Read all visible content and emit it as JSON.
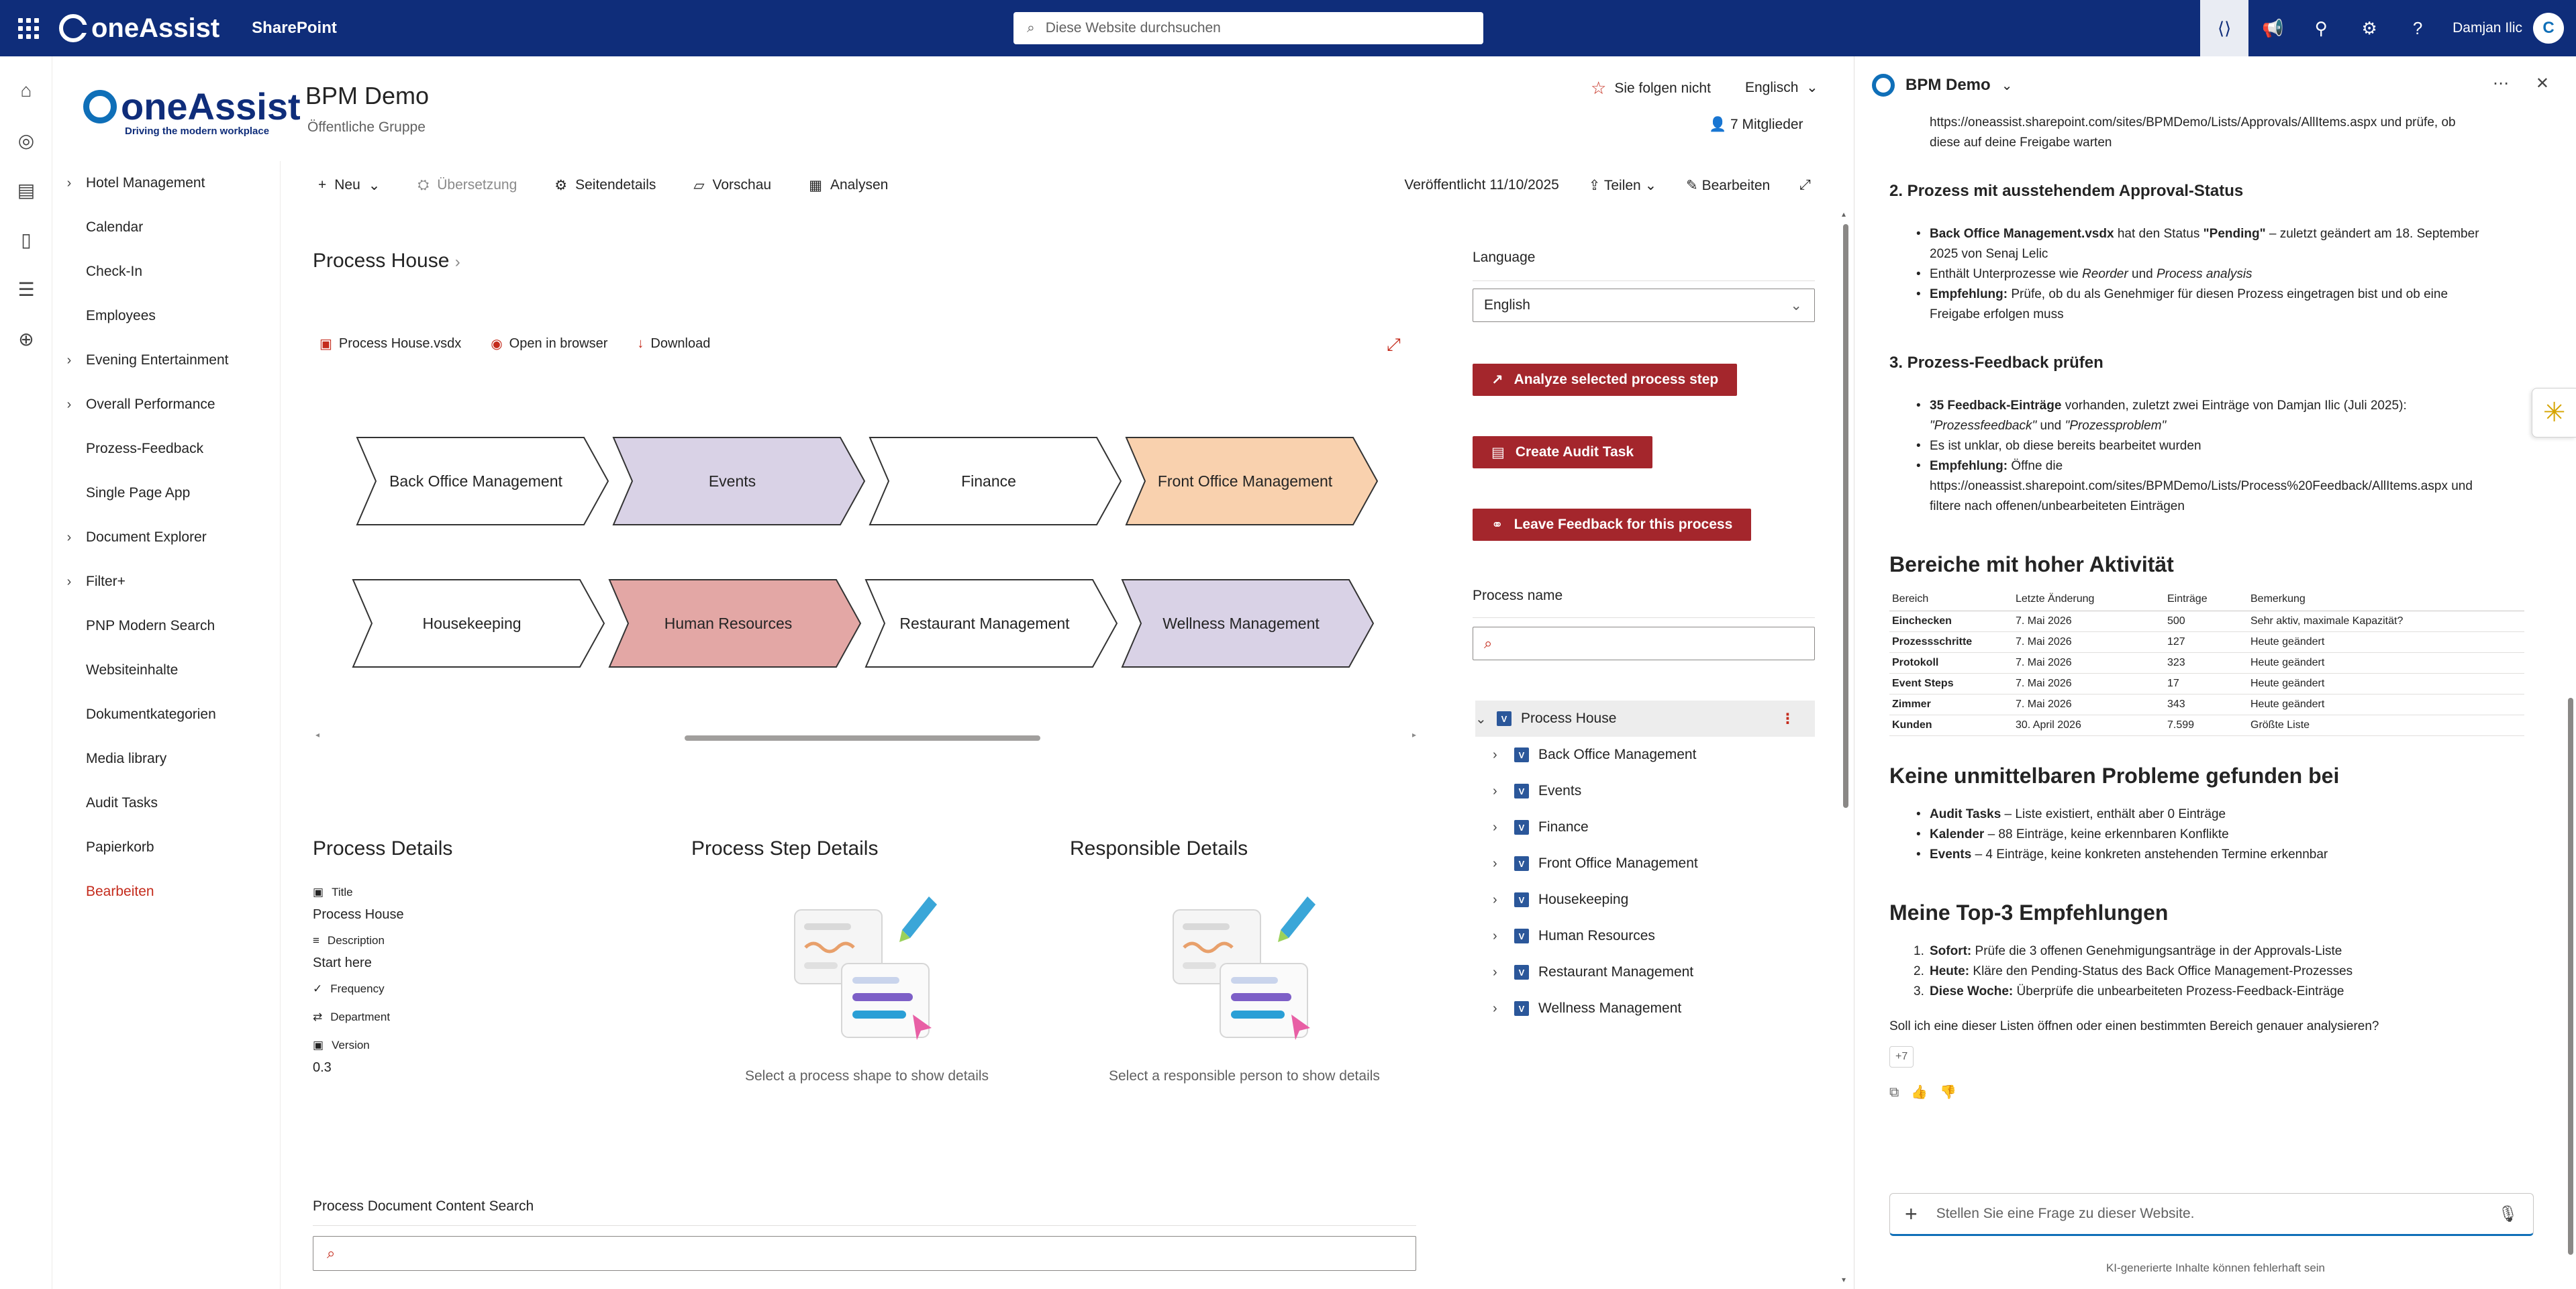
{
  "suitebar": {
    "brand": "oneAssist",
    "app": "SharePoint",
    "search_placeholder": "Diese Website durchsuchen",
    "user": "Damjan Ilic",
    "avatar_letter": "C"
  },
  "site": {
    "logo_brand": "oneAssist",
    "logo_tagline": "Driving the modern workplace",
    "title": "BPM Demo",
    "subtitle": "Öffentliche Gruppe",
    "follow": "Sie folgen nicht",
    "language": "Englisch",
    "members": "7 Mitglieder"
  },
  "nav": {
    "items": [
      {
        "label": "Hotel Management",
        "expandable": true
      },
      {
        "label": "Calendar",
        "expandable": false
      },
      {
        "label": "Check-In",
        "expandable": false
      },
      {
        "label": "Employees",
        "expandable": false
      },
      {
        "label": "Evening Entertainment",
        "expandable": true
      },
      {
        "label": "Overall Performance",
        "expandable": true
      },
      {
        "label": "Prozess-Feedback",
        "expandable": false
      },
      {
        "label": "Single Page App",
        "expandable": false
      },
      {
        "label": "Document Explorer",
        "expandable": true
      },
      {
        "label": "Filter+",
        "expandable": true
      },
      {
        "label": "PNP Modern Search",
        "expandable": false
      },
      {
        "label": "Websiteinhalte",
        "expandable": false
      },
      {
        "label": "Dokumentkategorien",
        "expandable": false
      },
      {
        "label": "Media library",
        "expandable": false
      },
      {
        "label": "Audit Tasks",
        "expandable": false
      },
      {
        "label": "Papierkorb",
        "expandable": false
      }
    ],
    "edit": "Bearbeiten"
  },
  "cmdbar": {
    "new": "Neu",
    "translation": "Übersetzung",
    "page_details": "Seitendetails",
    "preview": "Vorschau",
    "analytics": "Analysen",
    "published": "Veröffentlicht 11/10/2025",
    "share": "Teilen",
    "edit": "Bearbeiten"
  },
  "main": {
    "process_house_title": "Process House",
    "file_name": "Process House.vsdx",
    "open_in_browser": "Open in browser",
    "download": "Download",
    "chevrons_row1": [
      {
        "label": "Back Office Management",
        "fill": "#ffffff"
      },
      {
        "label": "Events",
        "fill": "#d9d2e6"
      },
      {
        "label": "Finance",
        "fill": "#ffffff"
      },
      {
        "label": "Front Office Management",
        "fill": "#f9d1ae"
      }
    ],
    "chevrons_row2": [
      {
        "label": "Housekeeping",
        "fill": "#ffffff"
      },
      {
        "label": "Human Resources",
        "fill": "#e3a7a5"
      },
      {
        "label": "Restaurant Management",
        "fill": "#ffffff"
      },
      {
        "label": "Wellness Management",
        "fill": "#d9d2e6"
      }
    ],
    "process_details": {
      "heading": "Process Details",
      "title_label": "Title",
      "title_value": "Process House",
      "description_label": "Description",
      "description_value": "Start here",
      "frequency_label": "Frequency",
      "department_label": "Department",
      "version_label": "Version",
      "version_value": "0.3"
    },
    "step_details": {
      "heading": "Process Step Details",
      "hint": "Select a process shape to show details"
    },
    "responsible_details": {
      "heading": "Responsible Details",
      "hint": "Select a responsible person to show details"
    },
    "doc_search_label": "Process Document Content Search"
  },
  "right": {
    "language_label": "Language",
    "language_value": "English",
    "btn_analyze": "Analyze selected process step",
    "btn_audit": "Create Audit Task",
    "btn_feedback": "Leave Feedback for this process",
    "process_name_label": "Process name",
    "tree_root": "Process House",
    "tree_items": [
      "Back Office Management",
      "Events",
      "Finance",
      "Front Office Management",
      "Housekeeping",
      "Human Resources",
      "Restaurant Management",
      "Wellness Management"
    ]
  },
  "copilot": {
    "title": "BPM Demo",
    "intro_line1": "https://oneassist.sharepoint.com/sites/BPMDemo/Lists/Approvals/AllItems.aspx und prüfe, ob",
    "intro_line2": "diese auf deine Freigabe warten",
    "h_approval": "2. Prozess mit ausstehendem Approval-Status",
    "approval_b1_bold": "Back Office Management.vsdx",
    "approval_b1_text": " hat den Status ",
    "approval_b1_status": "\"Pending\"",
    "approval_b1_rest": " – zuletzt geändert am 18. September",
    "approval_b1_line2": "2025 von Senaj Lelic",
    "approval_b2": "Enthält Unterprozesse wie ",
    "approval_b2_i1": "Reorder",
    "approval_b2_und": " und ",
    "approval_b2_i2": "Process analysis",
    "approval_b3_bold": "Empfehlung:",
    "approval_b3_text": " Prüfe, ob du als Genehmiger für diesen Prozess eingetragen bist und ob eine",
    "approval_b3_line2": "Freigabe erfolgen muss",
    "h_feedback": "3. Prozess-Feedback prüfen",
    "fb_b1_bold": "35 Feedback-Einträge",
    "fb_b1_text": " vorhanden, zuletzt zwei Einträge von Damjan Ilic (Juli 2025):",
    "fb_b1_line2a": "\"Prozessfeedback\"",
    "fb_b1_line2b": " und ",
    "fb_b1_line2c": "\"Prozessproblem\"",
    "fb_b2": "Es ist unklar, ob diese bereits bearbeitet wurden",
    "fb_b3_bold": "Empfehlung:",
    "fb_b3_text": " Öffne die",
    "fb_b3_line2": "https://oneassist.sharepoint.com/sites/BPMDemo/Lists/Process%20Feedback/AllItems.aspx und",
    "fb_b3_line3": "filtere nach offenen/unbearbeiteten Einträgen",
    "h_activity": "Bereiche mit hoher Aktivität",
    "table_headers": [
      "Bereich",
      "Letzte Änderung",
      "Einträge",
      "Bemerkung"
    ],
    "table_rows": [
      [
        "Einchecken",
        "7. Mai 2026",
        "500",
        "Sehr aktiv, maximale Kapazität?"
      ],
      [
        "Prozessschritte",
        "7. Mai 2026",
        "127",
        "Heute geändert"
      ],
      [
        "Protokoll",
        "7. Mai 2026",
        "323",
        "Heute geändert"
      ],
      [
        "Event Steps",
        "7. Mai 2026",
        "17",
        "Heute geändert"
      ],
      [
        "Zimmer",
        "7. Mai 2026",
        "343",
        "Heute geändert"
      ],
      [
        "Kunden",
        "30. April 2026",
        "7.599",
        "Größte Liste"
      ]
    ],
    "h_noproblems": "Keine unmittelbaren Probleme gefunden bei",
    "np_items": [
      {
        "bold": "Audit Tasks",
        "text": " – Liste existiert, enthält aber 0 Einträge"
      },
      {
        "bold": "Kalender",
        "text": " – 88 Einträge, keine erkennbaren Konflikte"
      },
      {
        "bold": "Events",
        "text": " – 4 Einträge, keine konkreten anstehenden Termine erkennbar"
      }
    ],
    "h_top3": "Meine Top-3 Empfehlungen",
    "top3": [
      {
        "n": "1.",
        "bold": "Sofort:",
        "text": " Prüfe die 3 offenen Genehmigungsanträge in der Approvals-Liste"
      },
      {
        "n": "2.",
        "bold": "Heute:",
        "text": " Kläre den Pending-Status des Back Office Management-Prozesses"
      },
      {
        "n": "3.",
        "bold": "Diese Woche:",
        "text": " Überprüfe die unbearbeiteten Prozess-Feedback-Einträge"
      }
    ],
    "question": "Soll ich eine dieser Listen öffnen oder einen bestimmten Bereich genauer analysieren?",
    "chip": "+7",
    "input_placeholder": "Stellen Sie eine Frage zu dieser Website.",
    "footer": "KI-generierte Inhalte können fehlerhaft sein"
  }
}
